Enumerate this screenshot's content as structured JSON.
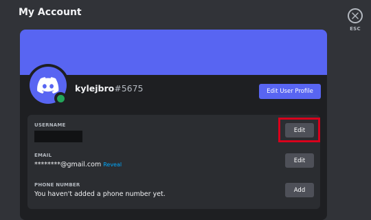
{
  "header": {
    "title": "My Account",
    "close_label": "ESC",
    "close_icon": "close-icon"
  },
  "profile": {
    "banner_color": "#5865f2",
    "avatar_icon": "discord-logo-icon",
    "status": "online",
    "status_color": "#23a55a",
    "username": "kylejbro",
    "discriminator": "#5675",
    "edit_profile_label": "Edit User Profile"
  },
  "fields": {
    "username": {
      "label": "USERNAME",
      "value_redacted": true,
      "button_label": "Edit",
      "highlighted": true
    },
    "email": {
      "label": "EMAIL",
      "value": "********@gmail.com",
      "reveal_label": "Reveal",
      "button_label": "Edit"
    },
    "phone": {
      "label": "PHONE NUMBER",
      "value": "You haven't added a phone number yet.",
      "button_label": "Add"
    }
  },
  "colors": {
    "accent": "#5865f2",
    "highlight_box": "#d8001c",
    "link": "#00a8fc"
  }
}
